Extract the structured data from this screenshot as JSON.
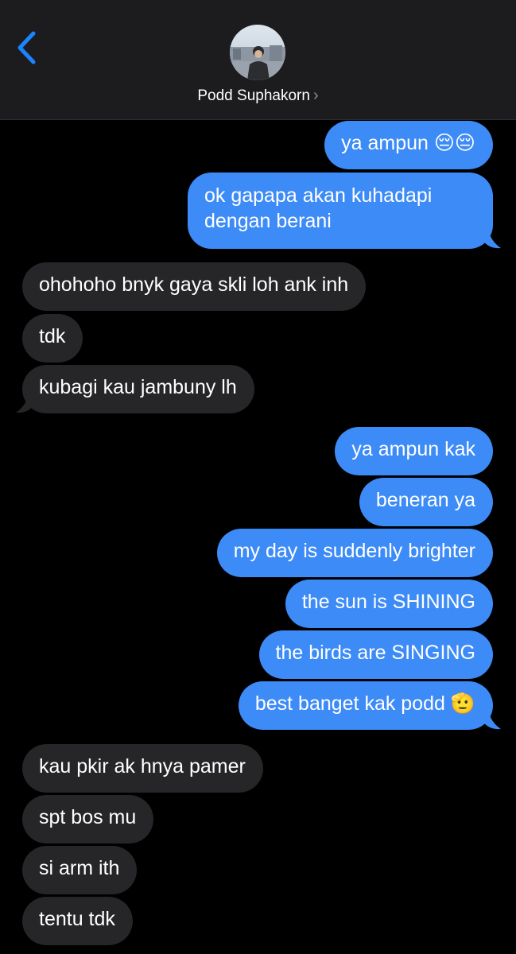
{
  "header": {
    "contact_name": "Podd Suphakorn",
    "chevron": "›",
    "back_icon": "chevron-left-icon",
    "accent_color": "#1a84ff",
    "avatar_icon": "contact-photo"
  },
  "colors": {
    "sent_bubble": "#3d8bf7",
    "received_bubble": "#262629",
    "background": "#000000",
    "header_background": "#1c1c1e"
  },
  "messages": [
    {
      "from": "me",
      "text": "ya ampun 😔😔"
    },
    {
      "from": "me",
      "text": "ok gapapa akan kuhadapi dengan berani"
    },
    {
      "from": "them",
      "text": "ohohoho bnyk gaya skli loh ank inh"
    },
    {
      "from": "them",
      "text": "tdk"
    },
    {
      "from": "them",
      "text": "kubagi kau jambuny lh"
    },
    {
      "from": "me",
      "text": "ya ampun kak"
    },
    {
      "from": "me",
      "text": "beneran ya"
    },
    {
      "from": "me",
      "text": "my day is suddenly brighter"
    },
    {
      "from": "me",
      "text": "the sun is SHINING"
    },
    {
      "from": "me",
      "text": "the birds are SINGING"
    },
    {
      "from": "me",
      "text": "best banget kak podd 🫡"
    },
    {
      "from": "them",
      "text": "kau pkir ak hnya pamer"
    },
    {
      "from": "them",
      "text": "spt bos mu"
    },
    {
      "from": "them",
      "text": "si arm ith"
    },
    {
      "from": "them",
      "text": "tentu tdk"
    }
  ]
}
